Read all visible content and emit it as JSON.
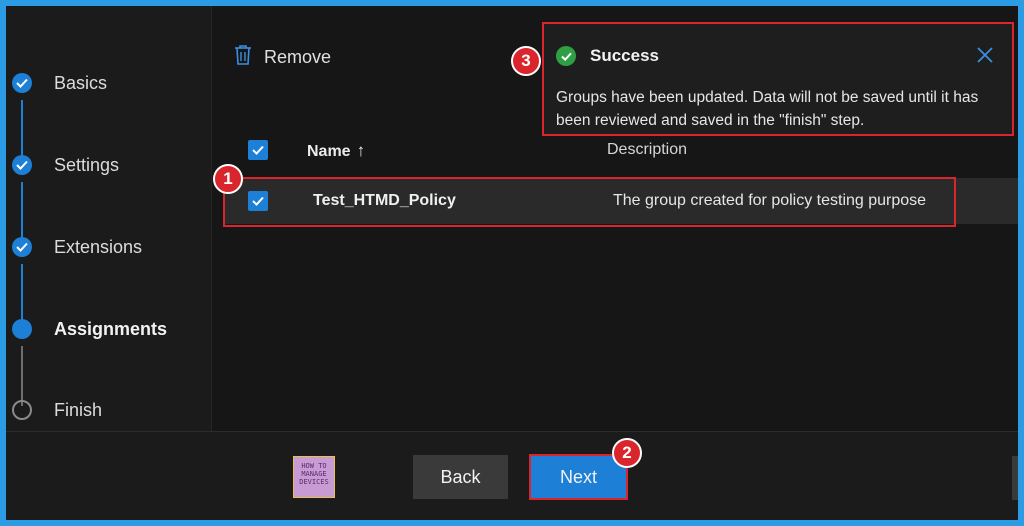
{
  "stepper": {
    "steps": [
      {
        "label": "Basics",
        "state": "done"
      },
      {
        "label": "Settings",
        "state": "done"
      },
      {
        "label": "Extensions",
        "state": "done"
      },
      {
        "label": "Assignments",
        "state": "current"
      },
      {
        "label": "Finish",
        "state": "todo"
      }
    ]
  },
  "toolbar": {
    "remove_label": "Remove",
    "remove_icon": "trash-icon"
  },
  "table": {
    "columns": [
      {
        "label": "Name",
        "sort": "↑"
      },
      {
        "label": "Description"
      }
    ],
    "rows": [
      {
        "name": "Test_HTMD_Policy",
        "description": "The group created for policy testing purpose",
        "checked": true
      }
    ]
  },
  "toast": {
    "title": "Success",
    "message": "Groups have been updated. Data will not be saved until it has been reviewed and saved in the \"finish\" step.",
    "status_icon": "check-circle-icon",
    "close_icon": "close-icon"
  },
  "footer": {
    "back_label": "Back",
    "next_label": "Next",
    "logo_text": [
      "HOW TO",
      "MANAGE",
      "DEVICES"
    ]
  },
  "annotations": [
    "1",
    "2",
    "3"
  ],
  "colors": {
    "accent": "#1d7fd6",
    "highlight": "#d9252b",
    "success": "#2ea043",
    "frame": "#2b9be4"
  }
}
